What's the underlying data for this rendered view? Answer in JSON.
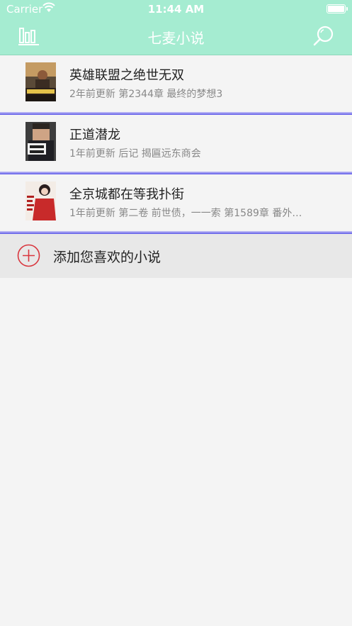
{
  "status_bar": {
    "carrier": "Carrier",
    "time": "11:44 AM"
  },
  "navbar": {
    "title": "七麦小说",
    "left_icon": "bar-chart-icon",
    "right_icon": "search-icon"
  },
  "books": [
    {
      "title": "英雄联盟之绝世无双",
      "info": "2年前更新 第2344章 最终的梦想3",
      "cover_text": "绝世无双"
    },
    {
      "title": "正道潜龙",
      "info": "1年前更新 后记 揭匾远东商会",
      "cover_text": "正道潜龙"
    },
    {
      "title": "全京城都在等我扑街",
      "info": "1年前更新 第二卷 前世债，一一索 第1589章 番外：...",
      "cover_text": "全京城都在等我扑街"
    }
  ],
  "add_row": {
    "label": "添加您喜欢的小说"
  },
  "colors": {
    "navbar_bg": "#a5ecd1",
    "separator": "#5a56e8",
    "add_icon": "#d9363e"
  }
}
